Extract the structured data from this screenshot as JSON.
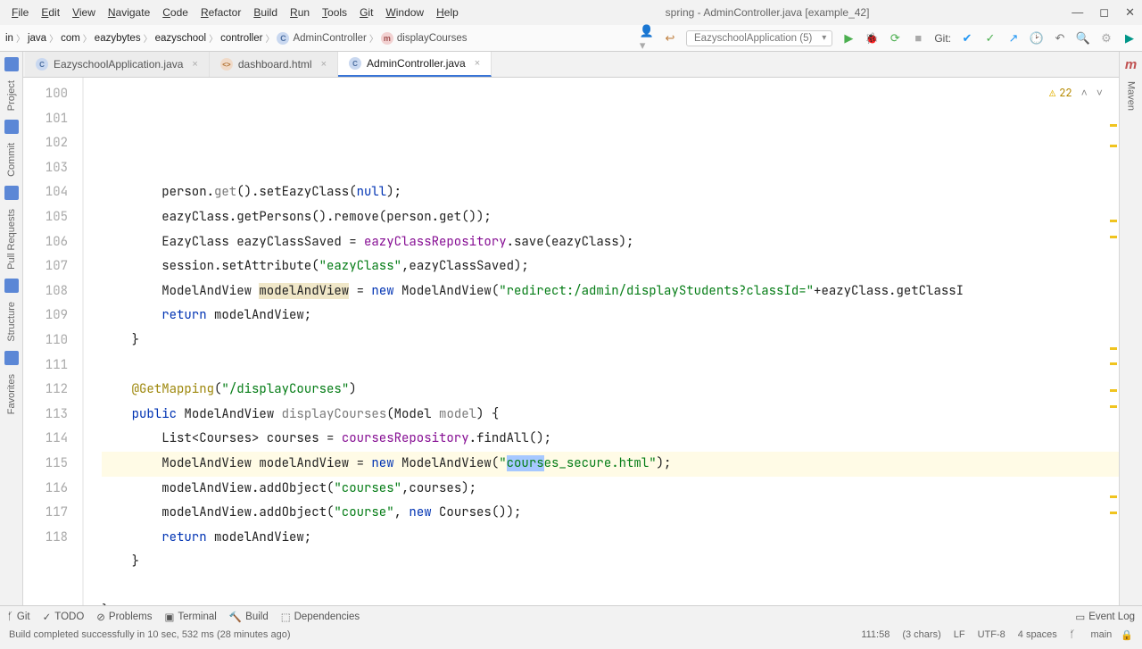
{
  "window": {
    "title": "spring - AdminController.java [example_42]"
  },
  "menu": [
    "File",
    "Edit",
    "View",
    "Navigate",
    "Code",
    "Refactor",
    "Build",
    "Run",
    "Tools",
    "Git",
    "Window",
    "Help"
  ],
  "breadcrumb": [
    "in",
    "java",
    "com",
    "eazybytes",
    "eazyschool",
    "controller",
    "AdminController",
    "displayCourses"
  ],
  "runConfig": "EazyschoolApplication (5)",
  "gitLabel": "Git:",
  "tabs": [
    {
      "label": "EazyschoolApplication.java",
      "type": "c"
    },
    {
      "label": "dashboard.html",
      "type": "h"
    },
    {
      "label": "AdminController.java",
      "type": "c",
      "active": true
    }
  ],
  "warnings": "22",
  "leftTools": [
    "Project",
    "Commit",
    "Pull Requests",
    "Structure",
    "Favorites"
  ],
  "rightTools": [
    "Maven"
  ],
  "code": {
    "startLine": 100,
    "lines": [
      {
        "html": "        person.<span class='mtd'>get</span>().setEazyClass(<span class='kw'>null</span>);"
      },
      {
        "html": "        eazyClass.getPersons().remove(person.get());"
      },
      {
        "html": "        EazyClass eazyClassSaved = <span class='fld'>eazyClassRepository</span>.save(eazyClass);"
      },
      {
        "html": "        session.setAttribute(<span class='str'>\"eazyClass\"</span>,eazyClassSaved);"
      },
      {
        "html": "        ModelAndView <span style='background:#f0e7c8'>modelAndView</span> = <span class='kw'>new</span> ModelAndView(<span class='str'>\"redirect:/admin/displayStudents?classId=\"</span>+eazyClass.getClassI"
      },
      {
        "html": "        <span class='kw'>return</span> modelAndView;"
      },
      {
        "html": "    }"
      },
      {
        "html": ""
      },
      {
        "html": "    <span class='ann'>@GetMapping</span>(<span class='str'>\"/displayCourses\"</span>)"
      },
      {
        "html": "    <span class='kw'>public</span> ModelAndView <span class='mtd'>displayCourses</span>(Model <span class='mtd'>model</span>) {"
      },
      {
        "html": "        List&lt;Courses&gt; courses = <span class='fld'>coursesRepository</span>.findAll();"
      },
      {
        "html": "        ModelAndView modelAndView = <span class='kw'>new</span> ModelAndView(<span class='str'>\"<span class='sel'>cours</span>es_secure.html\"</span>);",
        "active": true
      },
      {
        "html": "        modelAndView.addObject(<span class='str'>\"courses\"</span>,courses);"
      },
      {
        "html": "        modelAndView.addObject(<span class='str'>\"course\"</span>, <span class='kw'>new</span> Courses());"
      },
      {
        "html": "        <span class='kw'>return</span> modelAndView;"
      },
      {
        "html": "    }"
      },
      {
        "html": ""
      },
      {
        "html": "}"
      },
      {
        "html": ""
      }
    ]
  },
  "bottomTools": [
    "Git",
    "TODO",
    "Problems",
    "Terminal",
    "Build",
    "Dependencies"
  ],
  "eventLog": "Event Log",
  "status": {
    "msg": "Build completed successfully in 10 sec, 532 ms (28 minutes ago)",
    "caret": "111:58",
    "sel": "(3 chars)",
    "lineEnd": "LF",
    "enc": "UTF-8",
    "indent": "4 spaces",
    "branch": "main"
  }
}
